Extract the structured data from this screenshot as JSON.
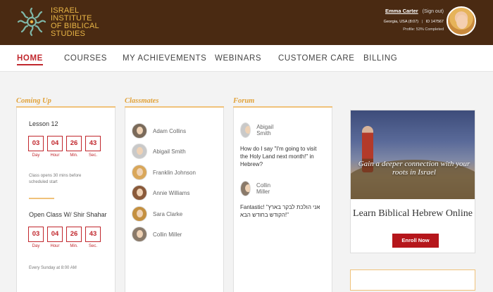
{
  "header": {
    "logo_lines": [
      "ISRAEL",
      "INSTITUTE",
      "of BIBLICAL",
      "STUDIES"
    ],
    "user_name": "Emma Carter",
    "sign_out": "(Sign out)",
    "location": "Georgia, USA (8:07)",
    "id_text": "ID 147567",
    "profile_status": "Profile: 53% Completed"
  },
  "nav": {
    "items": [
      "HOME",
      "COURSES",
      "MY ACHIEVEMENTS",
      "WEBINARS",
      "CUSTOMER CARE",
      "BILLING"
    ],
    "active": "HOME"
  },
  "coming_up": {
    "title": "Coming Up",
    "lesson1": {
      "name": "Lesson 12",
      "timer": [
        {
          "value": "03",
          "label": "Day"
        },
        {
          "value": "04",
          "label": "Hour"
        },
        {
          "value": "26",
          "label": "Min."
        },
        {
          "value": "43",
          "label": "Sec."
        }
      ],
      "note": "Class opens 30 mins before scheduled start"
    },
    "lesson2": {
      "name": "Open Class W/ Shir Shahar",
      "timer": [
        {
          "value": "03",
          "label": "Day"
        },
        {
          "value": "04",
          "label": "Hour"
        },
        {
          "value": "26",
          "label": "Min."
        },
        {
          "value": "43",
          "label": "Sec."
        }
      ],
      "note": "Every Sunday at 8:00 AM"
    }
  },
  "classmates": {
    "title": "Classmates",
    "items": [
      "Adam Collins",
      "Abigail Smith",
      "Franklin Johnson",
      "Annie Williams",
      "Sara Clarke",
      "Collin Miller"
    ]
  },
  "forum": {
    "title": "Forum",
    "posts": [
      {
        "user": "Abigail Smith",
        "text": "How do I say \"I'm going to visit the Holy Land next month!\" in Hebrew?"
      },
      {
        "user": "Collin Miller",
        "text": "Fantastic! \"אני הולכת לבקר בארץ הקודש בחודש הבא!\""
      }
    ]
  },
  "promo": {
    "caption": "Gain a deeper connection with your roots in Israel",
    "title": "Learn Biblical Hebrew Online",
    "button": "Enroll Now"
  },
  "colors": {
    "header_bg": "#4a2a12",
    "accent_gold": "#e1a23a",
    "accent_red": "#c1272d"
  }
}
